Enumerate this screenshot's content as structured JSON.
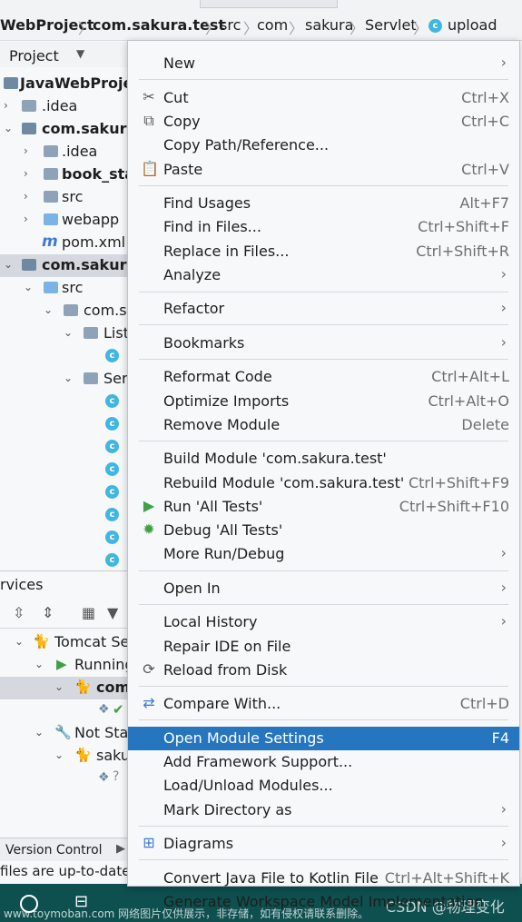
{
  "breadcrumb": {
    "project": "WebProject",
    "module": "com.sakura.test",
    "path": [
      "src",
      "com",
      "sakura",
      "Servlet"
    ],
    "file": "upload",
    "run_config": "com.sakura.test"
  },
  "project_panel": {
    "title": "Project",
    "items": [
      {
        "label": "JavaWebProjec",
        "bold": true
      },
      {
        "label": ".idea"
      },
      {
        "label": "com.sakura.",
        "bold": true
      },
      {
        "label": ".idea"
      },
      {
        "label": "book_stat",
        "bold": true
      },
      {
        "label": "src"
      },
      {
        "label": "webapp"
      },
      {
        "label": "pom.xml"
      },
      {
        "label": "com.sakura.",
        "bold": true
      },
      {
        "label": "src"
      },
      {
        "label": "com.sa"
      },
      {
        "label": "List"
      },
      {
        "label": "Ser"
      }
    ]
  },
  "services_panel": {
    "title": "rvices",
    "items": [
      {
        "label": "Tomcat Se"
      },
      {
        "label": "Running"
      },
      {
        "label": "com"
      },
      {
        "label": "Not Sta"
      },
      {
        "label": "saku"
      }
    ]
  },
  "bottom": {
    "version_control": "Version Control",
    "status": "files are up-to-date"
  },
  "watermark": "www.toymoban.com 网络图片仅供展示，非存储，如有侵权请联系删除。",
  "watermark2": "CSDN @物理变化",
  "menu": {
    "items": [
      {
        "label": "New",
        "shortcut": "",
        "submenu": true
      },
      {
        "label": "Cut",
        "shortcut": "Ctrl+X",
        "icon": "scissors"
      },
      {
        "label": "Copy",
        "shortcut": "Ctrl+C",
        "icon": "copy"
      },
      {
        "label": "Copy Path/Reference...",
        "shortcut": ""
      },
      {
        "label": "Paste",
        "shortcut": "Ctrl+V",
        "icon": "paste"
      },
      {
        "label": "Find Usages",
        "shortcut": "Alt+F7"
      },
      {
        "label": "Find in Files...",
        "shortcut": "Ctrl+Shift+F"
      },
      {
        "label": "Replace in Files...",
        "shortcut": "Ctrl+Shift+R"
      },
      {
        "label": "Analyze",
        "shortcut": "",
        "submenu": true
      },
      {
        "label": "Refactor",
        "shortcut": "",
        "submenu": true
      },
      {
        "label": "Bookmarks",
        "shortcut": "",
        "submenu": true
      },
      {
        "label": "Reformat Code",
        "shortcut": "Ctrl+Alt+L"
      },
      {
        "label": "Optimize Imports",
        "shortcut": "Ctrl+Alt+O"
      },
      {
        "label": "Remove Module",
        "shortcut": "Delete"
      },
      {
        "label": "Build Module 'com.sakura.test'",
        "shortcut": ""
      },
      {
        "label": "Rebuild Module 'com.sakura.test'",
        "shortcut": "Ctrl+Shift+F9"
      },
      {
        "label": "Run 'All Tests'",
        "shortcut": "Ctrl+Shift+F10",
        "icon": "run"
      },
      {
        "label": "Debug 'All Tests'",
        "shortcut": "",
        "icon": "debug"
      },
      {
        "label": "More Run/Debug",
        "shortcut": "",
        "submenu": true
      },
      {
        "label": "Open In",
        "shortcut": "",
        "submenu": true
      },
      {
        "label": "Local History",
        "shortcut": "",
        "submenu": true
      },
      {
        "label": "Repair IDE on File",
        "shortcut": ""
      },
      {
        "label": "Reload from Disk",
        "shortcut": "",
        "icon": "reload"
      },
      {
        "label": "Compare With...",
        "shortcut": "Ctrl+D",
        "icon": "compare"
      },
      {
        "label": "Open Module Settings",
        "shortcut": "F4",
        "highlighted": true
      },
      {
        "label": "Add Framework Support...",
        "shortcut": ""
      },
      {
        "label": "Load/Unload Modules...",
        "shortcut": ""
      },
      {
        "label": "Mark Directory as",
        "shortcut": "",
        "submenu": true
      },
      {
        "label": "Diagrams",
        "shortcut": "",
        "submenu": true,
        "icon": "diagram"
      },
      {
        "label": "Convert Java File to Kotlin File",
        "shortcut": "Ctrl+Alt+Shift+K"
      },
      {
        "label": "Generate Workspace Model Implementation",
        "shortcut": ""
      }
    ]
  },
  "colors": {
    "highlight": "#2675bf",
    "run": "#3fa046",
    "debug": "#3fa046"
  }
}
